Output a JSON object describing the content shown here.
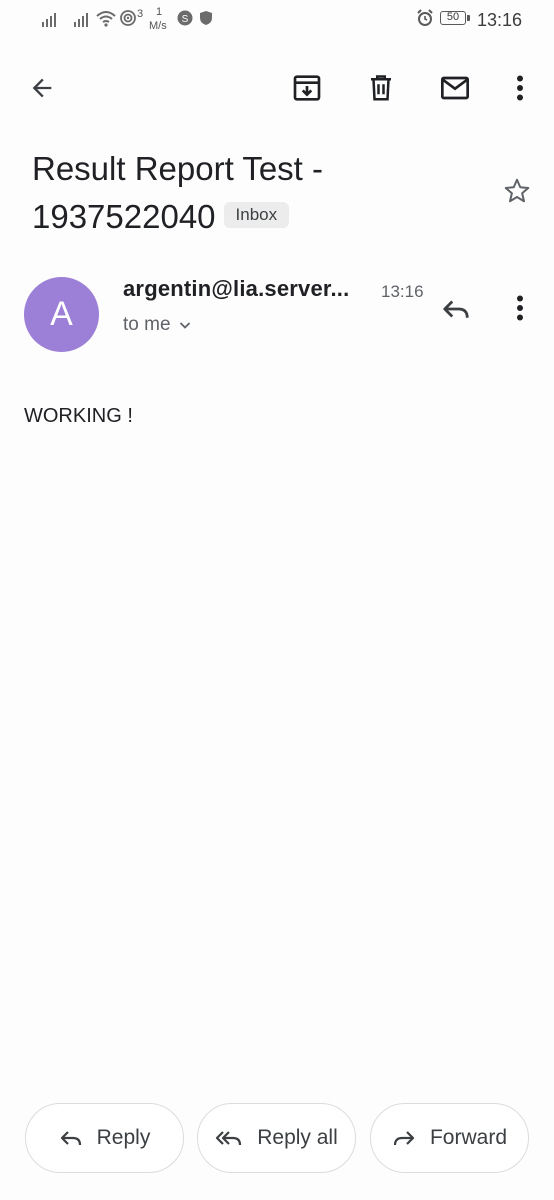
{
  "status_bar": {
    "network_speed_value": "1",
    "network_speed_unit": "M/s",
    "hotspot_count": "3",
    "battery": "50",
    "time": "13:16"
  },
  "toolbar": {
    "back": "back-icon",
    "archive": "archive-icon",
    "delete": "trash-icon",
    "mark_unread": "mail-icon",
    "more": "more-vert-icon"
  },
  "email": {
    "subject": "Result Report Test - 1937522040",
    "label": "Inbox",
    "sender_initial": "A",
    "sender": "argentin@lia.server...",
    "time": "13:16",
    "recipient": "to me",
    "body": "WORKING !"
  },
  "actions": {
    "reply": "Reply",
    "reply_all": "Reply all",
    "forward": "Forward"
  },
  "colors": {
    "avatar": "#9c7fd6",
    "background": "#fdfdfd"
  }
}
